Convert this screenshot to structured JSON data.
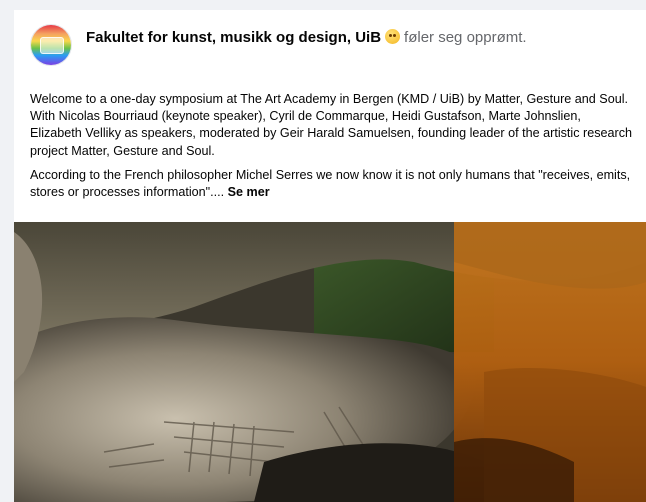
{
  "post": {
    "page_name": "Fakultet for kunst, musikk og design, UiB",
    "feeling_emoji": "smiling-face-icon",
    "feeling_text": "føler seg opprømt.",
    "paragraph_1": "Welcome to a one-day symposium at The Art Academy in Bergen (KMD / UiB) by Matter, Gesture and Soul. With Nicolas Bourriaud (keynote speaker), Cyril de Commarque, Heidi Gustafson, Marte Johnslien, Elizabeth Velliky as speakers, moderated by Geir Harald Samuelsen, founding leader of the artistic research project Matter, Gesture and Soul.",
    "paragraph_2": "According to the French philosopher Michel Serres we now know it is not only humans that \"receives, emits, stores or processes information\"....",
    "see_more_label": "Se mer"
  },
  "colors": {
    "name_text": "#050505",
    "secondary_text": "#65676b",
    "card_background": "#ffffff",
    "page_background": "#f0f2f5"
  }
}
